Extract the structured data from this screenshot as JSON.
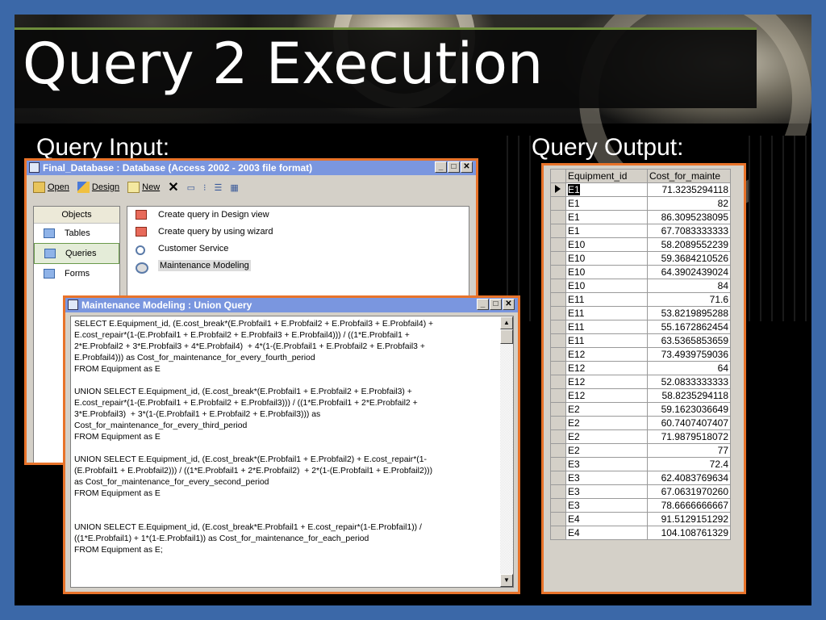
{
  "slide": {
    "title": "Query 2 Execution",
    "input_label": "Query Input:",
    "output_label": "Query Output:"
  },
  "access_window": {
    "title": "Final_Database : Database (Access 2002 - 2003 file format)",
    "toolbar": {
      "open": "Open",
      "design": "Design",
      "new": "New"
    },
    "objects_header": "Objects",
    "objects": [
      "Tables",
      "Queries",
      "Forms"
    ],
    "selected_object": "Queries",
    "queries": [
      "Create query in Design view",
      "Create query by using wizard",
      "Customer Service",
      "Maintenance Modeling"
    ],
    "highlighted_query": "Maintenance Modeling"
  },
  "sql_window": {
    "title": "Maintenance Modeling : Union Query",
    "sql": "SELECT E.Equipment_id, (E.cost_break*(E.Probfail1 + E.Probfail2 + E.Probfail3 + E.Probfail4) +\nE.cost_repair*(1-(E.Probfail1 + E.Probfail2 + E.Probfail3 + E.Probfail4))) / ((1*E.Probfail1 +\n2*E.Probfail2 + 3*E.Probfail3 + 4*E.Probfail4)  + 4*(1-(E.Probfail1 + E.Probfail2 + E.Probfail3 +\nE.Probfail4))) as Cost_for_maintenance_for_every_fourth_period\nFROM Equipment as E\n\nUNION SELECT E.Equipment_id, (E.cost_break*(E.Probfail1 + E.Probfail2 + E.Probfail3) +\nE.cost_repair*(1-(E.Probfail1 + E.Probfail2 + E.Probfail3))) / ((1*E.Probfail1 + 2*E.Probfail2 +\n3*E.Probfail3)  + 3*(1-(E.Probfail1 + E.Probfail2 + E.Probfail3))) as\nCost_for_maintenance_for_every_third_period\nFROM Equipment as E\n\nUNION SELECT E.Equipment_id, (E.cost_break*(E.Probfail1 + E.Probfail2) + E.cost_repair*(1-\n(E.Probfail1 + E.Probfail2))) / ((1*E.Probfail1 + 2*E.Probfail2)  + 2*(1-(E.Probfail1 + E.Probfail2)))\nas Cost_for_maintenance_for_every_second_period\nFROM Equipment as E\n\n\nUNION SELECT E.Equipment_id, (E.cost_break*E.Probfail1 + E.cost_repair*(1-E.Probfail1)) /\n((1*E.Probfail1) + 1*(1-E.Probfail1)) as Cost_for_maintenance_for_each_period\nFROM Equipment as E;"
  },
  "output": {
    "columns": [
      "Equipment_id",
      "Cost_for_mainte"
    ],
    "rows": [
      [
        "E1",
        "71.3235294118"
      ],
      [
        "E1",
        "82"
      ],
      [
        "E1",
        "86.3095238095"
      ],
      [
        "E1",
        "67.7083333333"
      ],
      [
        "E10",
        "58.2089552239"
      ],
      [
        "E10",
        "59.3684210526"
      ],
      [
        "E10",
        "64.3902439024"
      ],
      [
        "E10",
        "84"
      ],
      [
        "E11",
        "71.6"
      ],
      [
        "E11",
        "53.8219895288"
      ],
      [
        "E11",
        "55.1672862454"
      ],
      [
        "E11",
        "63.5365853659"
      ],
      [
        "E12",
        "73.4939759036"
      ],
      [
        "E12",
        "64"
      ],
      [
        "E12",
        "52.0833333333"
      ],
      [
        "E12",
        "58.8235294118"
      ],
      [
        "E2",
        "59.1623036649"
      ],
      [
        "E2",
        "60.7407407407"
      ],
      [
        "E2",
        "71.9879518072"
      ],
      [
        "E2",
        "77"
      ],
      [
        "E3",
        "72.4"
      ],
      [
        "E3",
        "62.4083769634"
      ],
      [
        "E3",
        "67.0631970260"
      ],
      [
        "E3",
        "78.6666666667"
      ],
      [
        "E4",
        "91.5129151292"
      ],
      [
        "E4",
        "104.108761329"
      ]
    ],
    "current_row": 0
  },
  "colors": {
    "frame_blue": "#3b68a8",
    "accent_orange": "#e8732a",
    "title_green": "#6e8d3c",
    "xp_title": "#7a96df"
  }
}
